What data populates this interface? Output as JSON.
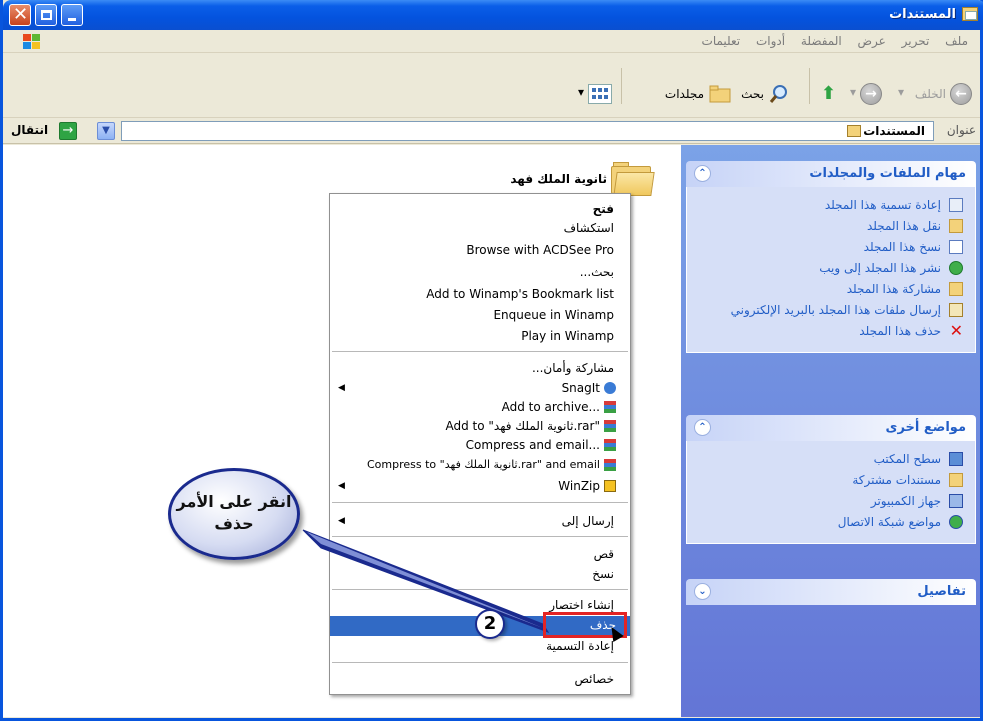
{
  "window": {
    "title": "المستندات",
    "buttons": {
      "close": "✕",
      "maximize": "□",
      "minimize": "_"
    }
  },
  "menubar": {
    "items": [
      "ملف",
      "تحرير",
      "عرض",
      "المفضلة",
      "أدوات",
      "تعليمات"
    ]
  },
  "toolbar": {
    "back_label": "الخلف",
    "search_label": "بحث",
    "folders_label": "مجلدات"
  },
  "address": {
    "label": "عنوان",
    "value": "المستندات",
    "go_label": "انتقال"
  },
  "taskpane": {
    "file_tasks": {
      "title": "مهام الملفات والمجلدات",
      "items": [
        "إعادة تسمية هذا المجلد",
        "نقل هذا المجلد",
        "نسخ هذا المجلد",
        "نشر هذا المجلد إلى ويب",
        "مشاركة هذا المجلد",
        "إرسال ملفات هذا المجلد بالبريد الإلكتروني",
        "حذف هذا المجلد"
      ]
    },
    "other_places": {
      "title": "مواضع أخرى",
      "items": [
        "سطح المكتب",
        "مستندات مشتركة",
        "جهاز الكمبيوتر",
        "مواضع شبكة الاتصال"
      ]
    },
    "details": {
      "title": "تفاصيل"
    }
  },
  "folder": {
    "name": "ثانوية الملك فهد"
  },
  "context_menu": {
    "items": [
      "فتح",
      "استكشاف",
      "Browse with ACDSee Pro",
      "بحث...",
      "Add to Winamp's Bookmark list",
      "Enqueue in Winamp",
      "Play in Winamp",
      "مشاركة وأمان...",
      "SnagIt",
      "Add to archive...",
      "Add to \"ثانوية الملك فهد.rar\"",
      "Compress and email...",
      "Compress to \"ثانوية الملك فهد.rar\" and email",
      "WinZip",
      "إرسال إلى",
      "قص",
      "نسخ",
      "إنشاء اختصار",
      "حذف",
      "إعادة التسمية",
      "خصائص"
    ]
  },
  "annotation": {
    "callout_text": "انقر على الأمر حذف",
    "step_number": "2"
  },
  "colors": {
    "titlebar": "#0453de",
    "taskpane": "#6f8ddf",
    "selection": "#316ac5",
    "highlight": "#e32424",
    "callout_border": "#1a2a8e"
  }
}
